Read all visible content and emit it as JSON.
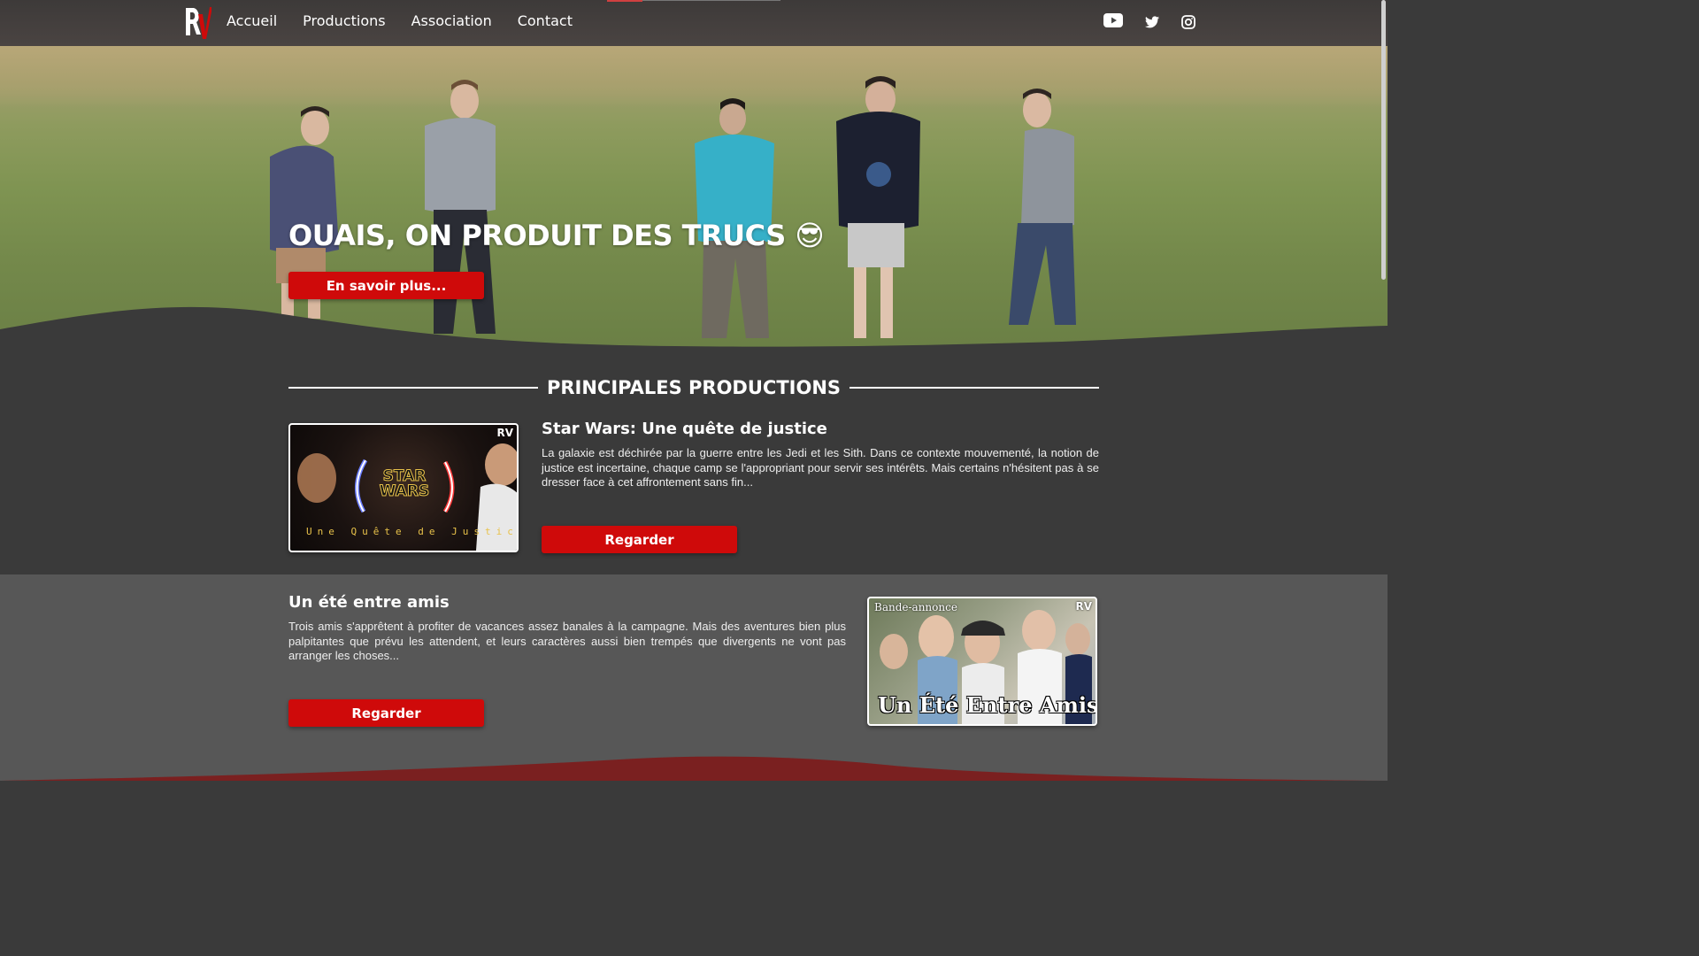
{
  "nav": {
    "logo_text": "RV",
    "links": [
      "Accueil",
      "Productions",
      "Association",
      "Contact"
    ],
    "social": [
      "youtube-icon",
      "twitter-icon",
      "instagram-icon"
    ]
  },
  "hero": {
    "title": "OUAIS, ON PRODUIT DES TRUCS 😎",
    "button": "En savoir plus..."
  },
  "section": {
    "title": "PRINCIPALES PRODUCTIONS"
  },
  "productions": [
    {
      "title": "Star Wars: Une quête de justice",
      "description": "La galaxie est déchirée par la guerre entre les Jedi et les Sith. Dans ce contexte mouvementé, la notion de justice est incertaine, chaque camp se l'appropriant pour servir ses intérêts. Mais certains n'hésitent pas à se dresser face à cet affrontement sans fin...",
      "button": "Regarder",
      "thumb_logo": "STAR WARS",
      "thumb_subtitle": "Une Quête de Justice",
      "thumb_badge": "RV"
    },
    {
      "title": "Un été entre amis",
      "description": "Trois amis s'apprêtent à profiter de vacances assez banales à la campagne. Mais des aventures bien plus palpitantes que prévu les attendent, et leurs caractères aussi bien trempés que divergents ne vont pas arranger les choses...",
      "button": "Regarder",
      "thumb_label": "Bande-annonce",
      "thumb_title": "Un Été Entre Amis",
      "thumb_badge": "RV"
    }
  ],
  "colors": {
    "accent": "#cf0a0a",
    "dark": "#3a3a3a",
    "mid": "#575757",
    "footer_wave": "#7a2020"
  }
}
